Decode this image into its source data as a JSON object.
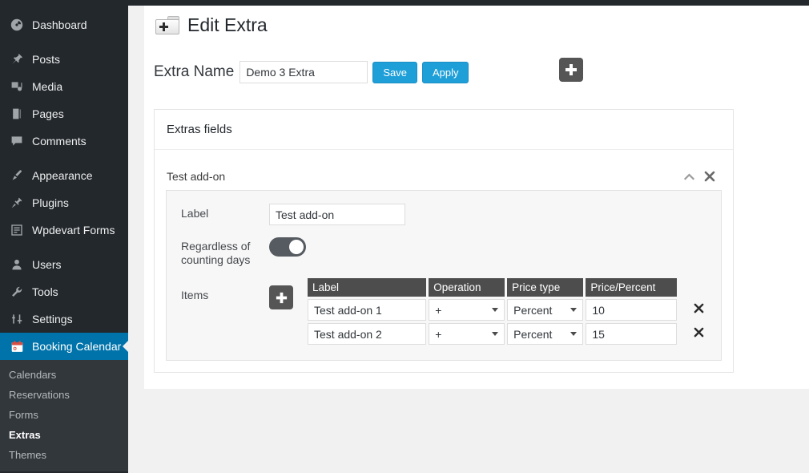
{
  "sidebar": {
    "items": [
      {
        "label": "Dashboard",
        "icon": "dashboard-icon",
        "active": false
      },
      {
        "label": "Posts",
        "icon": "pin-icon",
        "active": false
      },
      {
        "label": "Media",
        "icon": "media-icon",
        "active": false
      },
      {
        "label": "Pages",
        "icon": "pages-icon",
        "active": false
      },
      {
        "label": "Comments",
        "icon": "comments-icon",
        "active": false
      },
      {
        "label": "Appearance",
        "icon": "brush-icon",
        "active": false
      },
      {
        "label": "Plugins",
        "icon": "plugin-icon",
        "active": false
      },
      {
        "label": "Wpdevart Forms",
        "icon": "form-icon",
        "active": false
      },
      {
        "label": "Users",
        "icon": "user-icon",
        "active": false
      },
      {
        "label": "Tools",
        "icon": "wrench-icon",
        "active": false
      },
      {
        "label": "Settings",
        "icon": "settings-icon",
        "active": false
      },
      {
        "label": "Booking Calendar",
        "icon": "calendar-icon",
        "active": true
      }
    ],
    "submenu": [
      {
        "label": "Calendars",
        "current": false
      },
      {
        "label": "Reservations",
        "current": false
      },
      {
        "label": "Forms",
        "current": false
      },
      {
        "label": "Extras",
        "current": true
      },
      {
        "label": "Themes",
        "current": false
      }
    ],
    "active_color": "#0073aa",
    "background_color": "#23282d"
  },
  "page": {
    "title": "Edit Extra",
    "title_icon": "folder-plus-icon"
  },
  "extra_name": {
    "label": "Extra Name",
    "value": "Demo 3 Extra",
    "placeholder": "",
    "save_label": "Save",
    "apply_label": "Apply",
    "button_color": "#1e9fd8"
  },
  "top_add_button": {
    "icon": "plus-icon",
    "color": "#555555"
  },
  "panel": {
    "heading": "Extras fields"
  },
  "addon": {
    "title": "Test add-on",
    "collapse_icon": "chevron-up-icon",
    "close_icon": "close-x-icon",
    "label_field": {
      "label": "Label",
      "value": "Test add-on",
      "placeholder": ""
    },
    "regardless": {
      "label": "Regardless of counting days",
      "toggle_on": true,
      "toggle_color": "#555b60"
    },
    "items": {
      "label": "Items",
      "add_icon": "plus-icon",
      "columns": [
        "Label",
        "Operation",
        "Price type",
        "Price/Percent"
      ],
      "rows": [
        {
          "label": "Test add-on 1",
          "operation": "+",
          "price_type": "Percent",
          "price": "10",
          "delete_icon": "close-x-icon"
        },
        {
          "label": "Test add-on 2",
          "operation": "+",
          "price_type": "Percent",
          "price": "15",
          "delete_icon": "close-x-icon"
        }
      ]
    }
  }
}
